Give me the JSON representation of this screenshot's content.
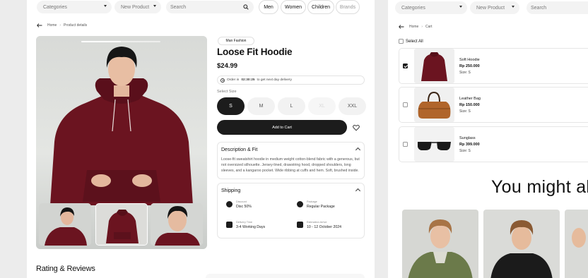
{
  "left": {
    "topbar": {
      "categories": "Categories",
      "new_product": "New Product",
      "search_placeholder": "Search",
      "men": "Men",
      "women": "Women",
      "children": "Children",
      "brands": "Brands"
    },
    "breadcrumb": [
      "Home",
      "Product details"
    ],
    "product": {
      "tag": "Man Fashion",
      "title": "Loose Fit Hoodie",
      "price": "$24.99",
      "delivery_prefix": "Order in",
      "delivery_time": "02:30:25",
      "delivery_suffix": "to get next day delivery",
      "select_size": "Select Size",
      "sizes": [
        "S",
        "M",
        "L",
        "XL",
        "XXL"
      ],
      "selected_size": "S",
      "disabled_size": "XL",
      "add_to_cart": "Add to Cart"
    },
    "description": {
      "title": "Description & Fit",
      "text": "Loose-fit sweatshirt hoodie in medium weight cotton-blend fabric with a generous, but not oversized silhouette. Jersey-lined, drawstring hood, dropped shoulders, long sleeves, and a kangaroo pocket. Wide ribbing at cuffs and hem. Soft, brushed inside."
    },
    "shipping": {
      "title": "Shipping",
      "items": [
        {
          "label": "Discount",
          "value": "Disc 50%",
          "icon": "discount-icon"
        },
        {
          "label": "Package",
          "value": "Regular Package",
          "icon": "package-icon"
        },
        {
          "label": "Delivery Time",
          "value": "3-4 Working Days",
          "icon": "calendar-icon"
        },
        {
          "label": "Estimation Arrive",
          "value": "10 - 12 October 2024",
          "icon": "truck-icon"
        }
      ]
    },
    "rating_title": "Rating & Reviews"
  },
  "right": {
    "topbar": {
      "categories": "Categories",
      "new_product": "New Product",
      "search_placeholder": "Search"
    },
    "breadcrumb": [
      "Home",
      "Cart"
    ],
    "select_all": "Select All",
    "items": [
      {
        "name": "Soft Hoodie",
        "price": "Rp 250.000",
        "size": "Size: S",
        "checked": true
      },
      {
        "name": "Leather Bag",
        "price": "Rp 150.000",
        "size": "Size: S",
        "checked": false
      },
      {
        "name": "Sunglass",
        "price": "Rp 399.000",
        "size": "Size: S",
        "checked": false
      }
    ],
    "you_might_also": "You might als"
  },
  "colors": {
    "primary": "#1c1c1c",
    "hoodie": "#6b1420",
    "background": "#ececec"
  }
}
